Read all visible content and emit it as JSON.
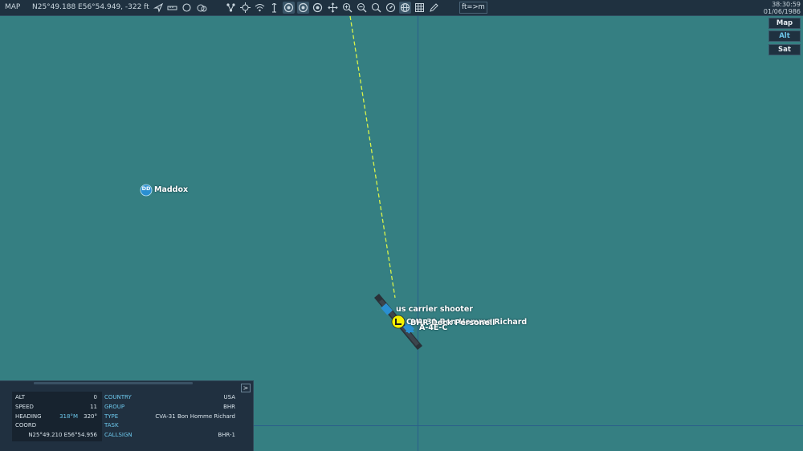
{
  "topbar": {
    "title": "MAP",
    "cursor_coord": "N25°49.188 E56°54.949, -322 ft",
    "units_toggle": "ft=>m",
    "clock_time": "38:30:59",
    "clock_date": "01/06/1986",
    "icons": [
      "navigate-icon",
      "ruler-icon",
      "circle-icon",
      "group-icon",
      "route-icon",
      "target-icon",
      "wifi-icon",
      "tower-icon",
      "radar-ring-icon",
      "radar-ring-icon",
      "radar-ring-icon",
      "move-icon",
      "zoom-in-icon",
      "zoom-out-icon",
      "zoom-fit-icon",
      "compass-icon",
      "globe-icon",
      "grid-icon",
      "pencil-icon"
    ]
  },
  "layers": {
    "map": "Map",
    "alt": "Alt",
    "sat": "Sat"
  },
  "map_units": [
    {
      "marker": "DD",
      "name": "Maddox"
    },
    {
      "name": "us carrier shooter"
    },
    {
      "name": "CVA-31 Bon Homme Richard"
    },
    {
      "name": "BHR Deck Personell"
    },
    {
      "name": "A-4E-C"
    }
  ],
  "panel": {
    "alt_label": "ALT",
    "alt_value": "0",
    "speed_label": "SPEED",
    "speed_value": "11",
    "heading_label": "HEADING",
    "heading_mag": "318°M",
    "heading_true": "320°",
    "coord_label": "COORD",
    "coord_value": "N25°49.210 E56°54.956",
    "country_label": "COUNTRY",
    "country_value": "USA",
    "group_label": "GROUP",
    "group_value": "BHR",
    "type_label": "TYPE",
    "type_value": "CVA-31 Bon Homme Richard",
    "task_label": "TASK",
    "task_value": "",
    "callsign_label": "CALLSIGN",
    "callsign_value": "BHR-1",
    "expand": ">"
  },
  "colors": {
    "sea": "#357f82",
    "route_line": "#d8f24a",
    "accent": "#6cc6ea",
    "toolbar": "#1f3140"
  }
}
